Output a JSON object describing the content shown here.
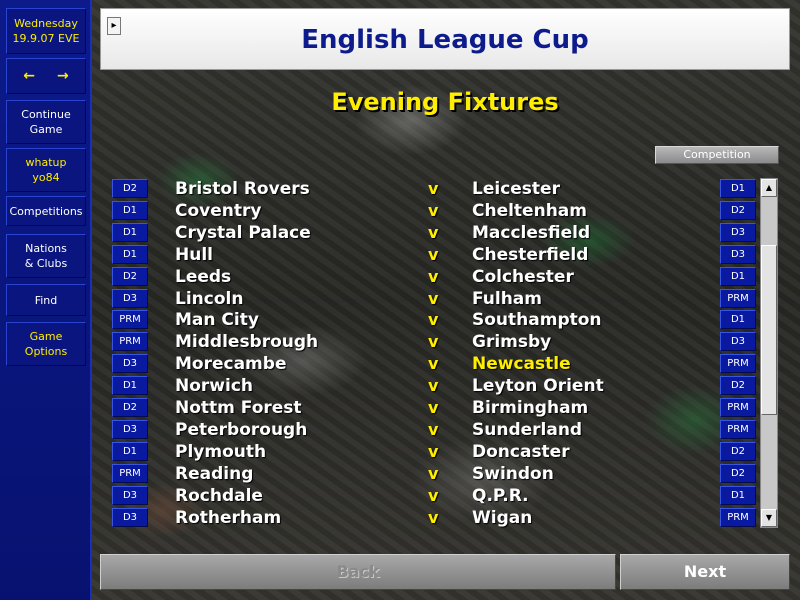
{
  "sidebar": {
    "date_day": "Wednesday",
    "date_value": "19.9.07 EVE",
    "back_arrow": "←",
    "forward_arrow": "→",
    "items": [
      {
        "label": "Continue Game"
      },
      {
        "label": "whatup yo84"
      },
      {
        "label": "Competitions"
      },
      {
        "label": "Nations & Clubs"
      },
      {
        "label": "Find"
      },
      {
        "label": "Game Options"
      }
    ]
  },
  "header": {
    "title": "English League Cup",
    "expand_arrow": "▸"
  },
  "subtitle": "Evening Fixtures",
  "competition_button": "Competition",
  "fixtures": [
    {
      "home_div": "D2",
      "home": "Bristol Rovers",
      "vs": "v",
      "away": "Leicester",
      "away_div": "D1"
    },
    {
      "home_div": "D1",
      "home": "Coventry",
      "vs": "v",
      "away": "Cheltenham",
      "away_div": "D2"
    },
    {
      "home_div": "D1",
      "home": "Crystal Palace",
      "vs": "v",
      "away": "Macclesfield",
      "away_div": "D3"
    },
    {
      "home_div": "D1",
      "home": "Hull",
      "vs": "v",
      "away": "Chesterfield",
      "away_div": "D3"
    },
    {
      "home_div": "D2",
      "home": "Leeds",
      "vs": "v",
      "away": "Colchester",
      "away_div": "D1"
    },
    {
      "home_div": "D3",
      "home": "Lincoln",
      "vs": "v",
      "away": "Fulham",
      "away_div": "PRM"
    },
    {
      "home_div": "PRM",
      "home": "Man City",
      "vs": "v",
      "away": "Southampton",
      "away_div": "D1"
    },
    {
      "home_div": "PRM",
      "home": "Middlesbrough",
      "vs": "v",
      "away": "Grimsby",
      "away_div": "D3"
    },
    {
      "home_div": "D3",
      "home": "Morecambe",
      "vs": "v",
      "away": "Newcastle",
      "away_div": "PRM",
      "away_highlight": true
    },
    {
      "home_div": "D1",
      "home": "Norwich",
      "vs": "v",
      "away": "Leyton Orient",
      "away_div": "D2"
    },
    {
      "home_div": "D2",
      "home": "Nottm Forest",
      "vs": "v",
      "away": "Birmingham",
      "away_div": "PRM"
    },
    {
      "home_div": "D3",
      "home": "Peterborough",
      "vs": "v",
      "away": "Sunderland",
      "away_div": "PRM"
    },
    {
      "home_div": "D1",
      "home": "Plymouth",
      "vs": "v",
      "away": "Doncaster",
      "away_div": "D2"
    },
    {
      "home_div": "PRM",
      "home": "Reading",
      "vs": "v",
      "away": "Swindon",
      "away_div": "D2"
    },
    {
      "home_div": "D3",
      "home": "Rochdale",
      "vs": "v",
      "away": "Q.P.R.",
      "away_div": "D1"
    },
    {
      "home_div": "D3",
      "home": "Rotherham",
      "vs": "v",
      "away": "Wigan",
      "away_div": "PRM"
    }
  ],
  "scrollbar": {
    "up": "▲",
    "down": "▼"
  },
  "buttons": {
    "back": "Back",
    "next": "Next"
  },
  "colors": {
    "accent": "#ffee00",
    "sidebar": "#0a1580",
    "title": "#0d1b8c"
  }
}
